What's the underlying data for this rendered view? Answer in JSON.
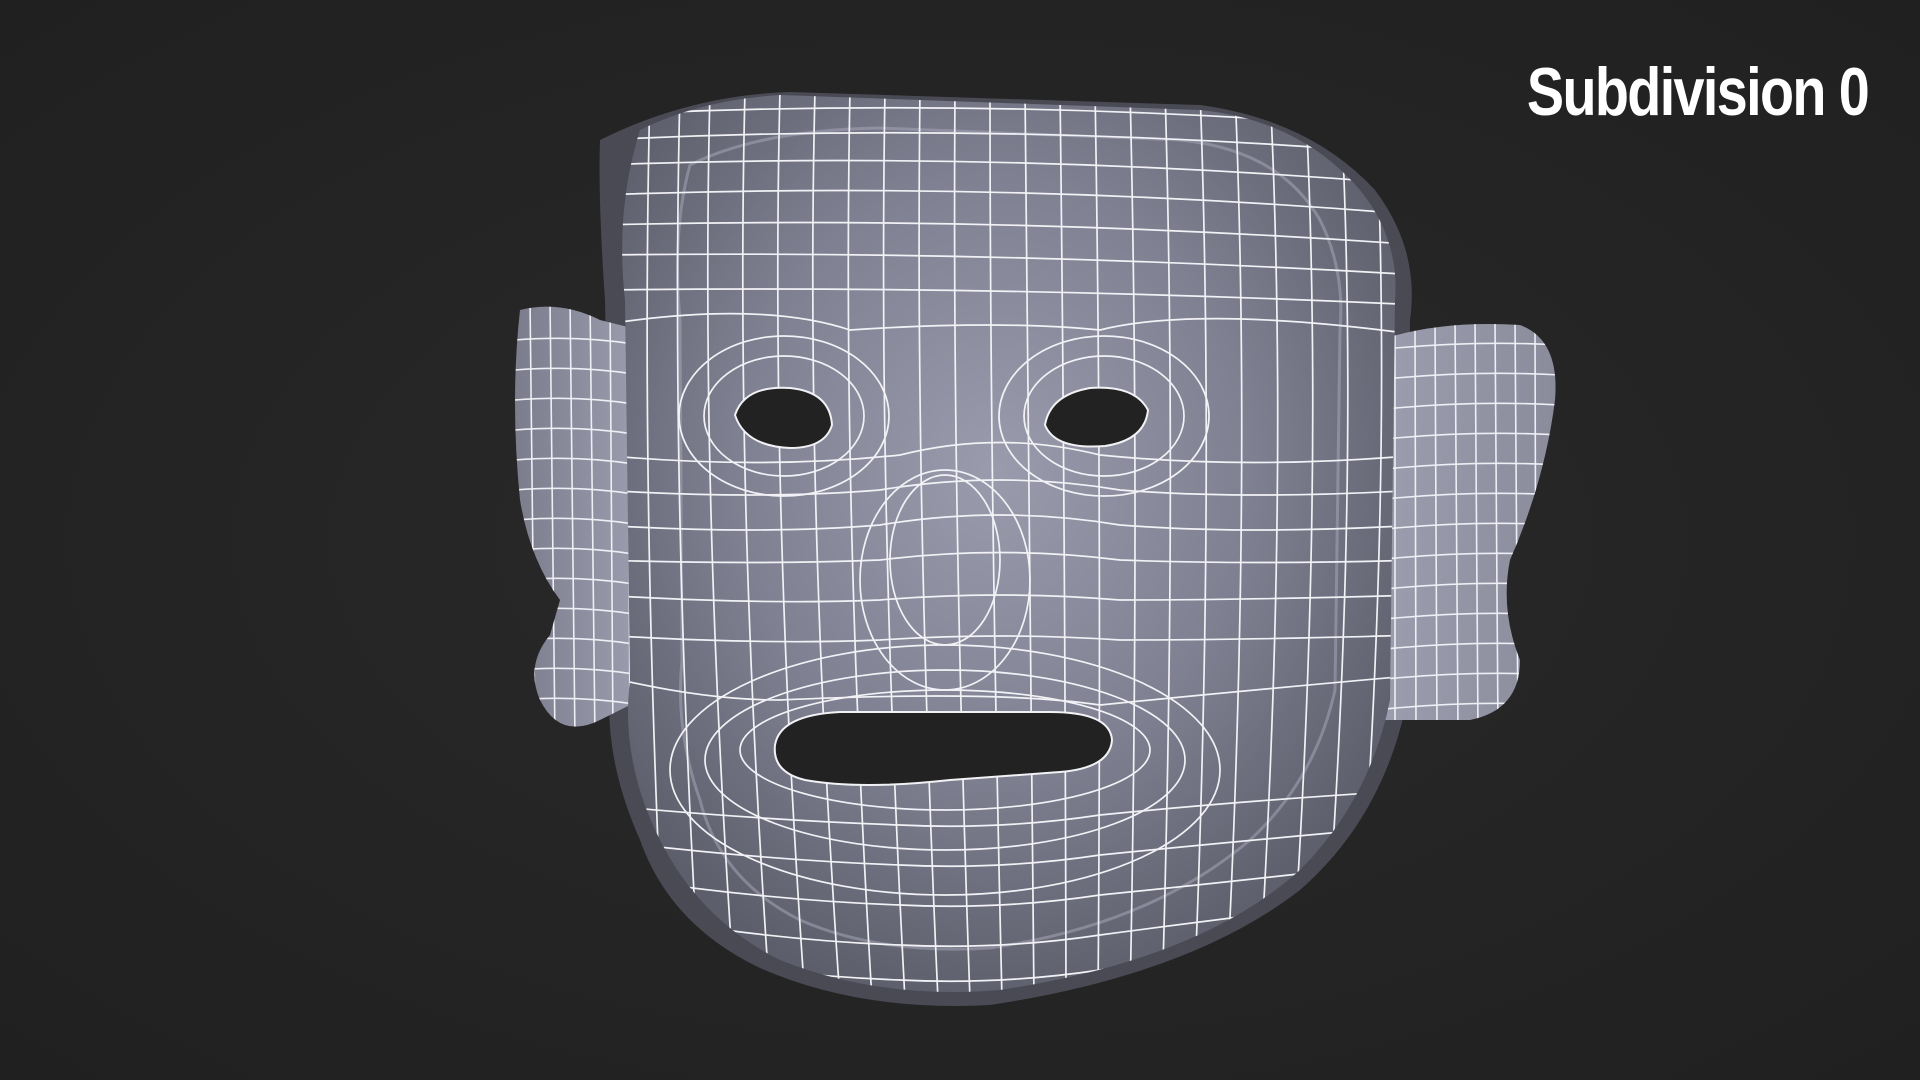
{
  "overlay": {
    "label": "Subdivision 0"
  },
  "scene": {
    "object": "mask-mesh",
    "shading": "wireframe-on-shaded",
    "colors": {
      "background": "#242424",
      "surface": "#8e8fa0",
      "surface_shadow": "#5a5b68",
      "wire": "#f2f2f6",
      "holes": "#222222"
    }
  }
}
